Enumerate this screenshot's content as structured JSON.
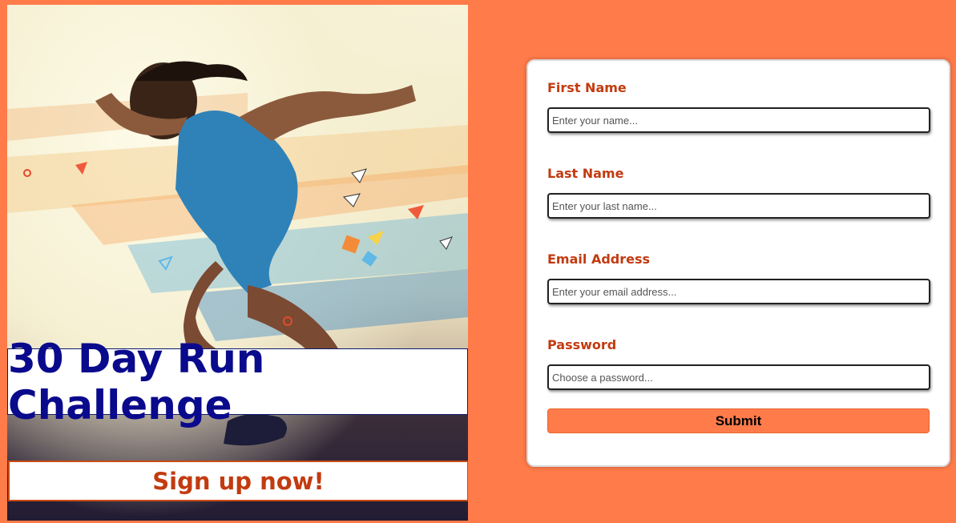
{
  "colors": {
    "page_background": "#ff7b4a",
    "title_text": "#0a0a8c",
    "accent_text": "#c23b10",
    "button_background": "#ff7b4a"
  },
  "hero": {
    "image_name": "sprinting-runner-paint-splash",
    "title": "30 Day Run Challenge",
    "cta": "Sign up now!"
  },
  "form": {
    "first_name": {
      "label": "First Name",
      "placeholder": "Enter your name..."
    },
    "last_name": {
      "label": "Last Name",
      "placeholder": "Enter your last name..."
    },
    "email": {
      "label": "Email Address",
      "placeholder": "Enter your email address..."
    },
    "password": {
      "label": "Password",
      "placeholder": "Choose a password..."
    },
    "submit_label": "Submit"
  }
}
